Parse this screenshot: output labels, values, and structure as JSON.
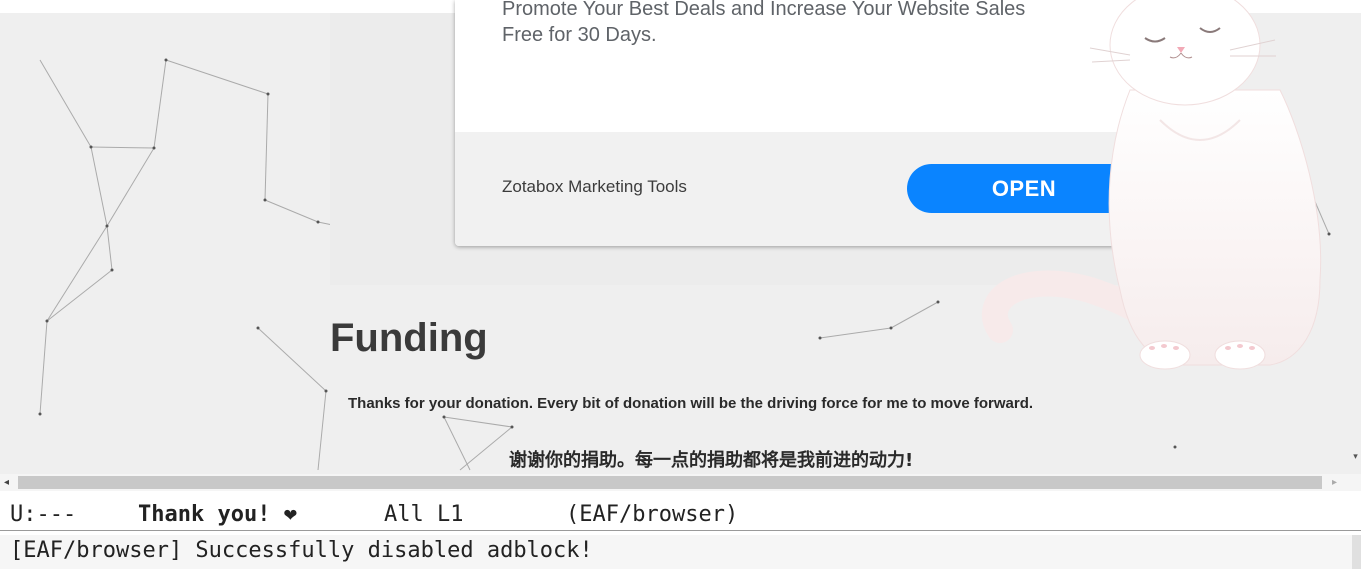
{
  "browser": {
    "ad_card": {
      "text_line1": "Promote Your Best Deals and Increase Your Website Sales",
      "text_line2": "Free for 30 Days.",
      "brand": "Zotabox Marketing Tools",
      "cta_label": "OPEN",
      "cta_color": "#0a84ff"
    },
    "funding": {
      "title": "Funding",
      "text_en": "Thanks for your donation. Every bit of donation will be the driving force for me to move forward.",
      "text_zh": "谢谢你的捐助。每一点的捐助都将是我前进的动力!"
    },
    "decoration": {
      "mascot": "cat-illustration",
      "background": "particle-constellation"
    }
  },
  "scrollbar": {
    "left_arrow": "◂",
    "right_arrow": "▸",
    "down_arrow": "▾"
  },
  "modeline": {
    "status": "U:---",
    "buffer_name": "Thank you! ❤",
    "position": "All L1",
    "mode": "(EAF/browser)"
  },
  "minibuffer": {
    "message": "[EAF/browser] Successfully disabled adblock!"
  }
}
